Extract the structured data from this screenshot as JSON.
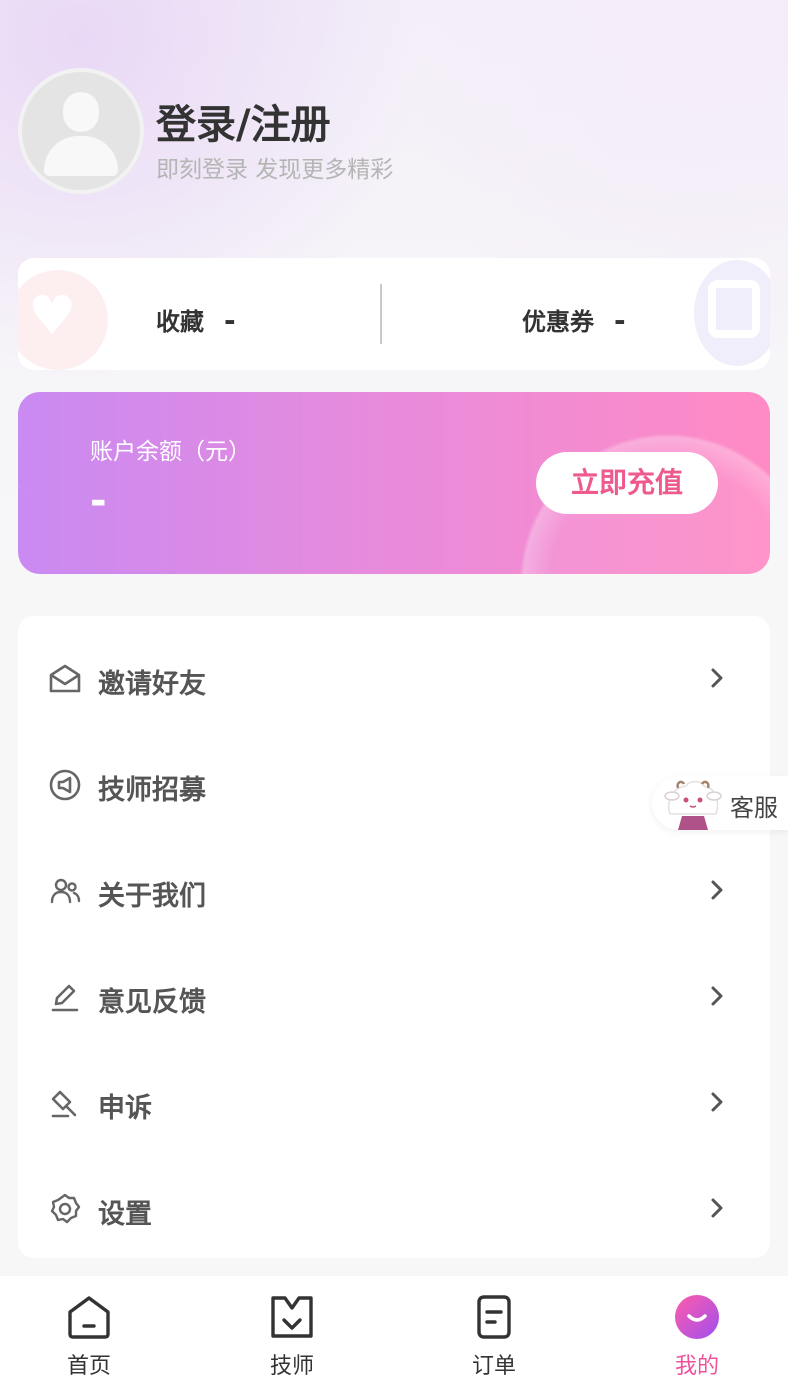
{
  "header": {
    "title": "登录/注册",
    "subtitle": "即刻登录 发现更多精彩"
  },
  "stats": {
    "favorites_label": "收藏",
    "favorites_value": "-",
    "coupons_label": "优惠券",
    "coupons_value": "-"
  },
  "balance": {
    "label": "账户余额（元）",
    "value": "-",
    "recharge_label": "立即充值"
  },
  "menu": {
    "items": [
      {
        "label": "邀请好友",
        "icon": "envelope-icon"
      },
      {
        "label": "技师招募",
        "icon": "megaphone-icon"
      },
      {
        "label": "关于我们",
        "icon": "users-icon"
      },
      {
        "label": "意见反馈",
        "icon": "pencil-icon"
      },
      {
        "label": "申诉",
        "icon": "gavel-icon"
      },
      {
        "label": "设置",
        "icon": "gear-icon"
      }
    ]
  },
  "service": {
    "label": "客服"
  },
  "tabbar": {
    "items": [
      {
        "label": "首页",
        "icon": "home-icon",
        "active": false
      },
      {
        "label": "技师",
        "icon": "technician-icon",
        "active": false
      },
      {
        "label": "订单",
        "icon": "order-icon",
        "active": false
      },
      {
        "label": "我的",
        "icon": "profile-icon",
        "active": true
      }
    ]
  },
  "colors": {
    "accent": "#f0539c",
    "balance_gradient_start": "#c98af2",
    "balance_gradient_end": "#ff8bc5",
    "recharge_text": "#ee5a8e"
  }
}
